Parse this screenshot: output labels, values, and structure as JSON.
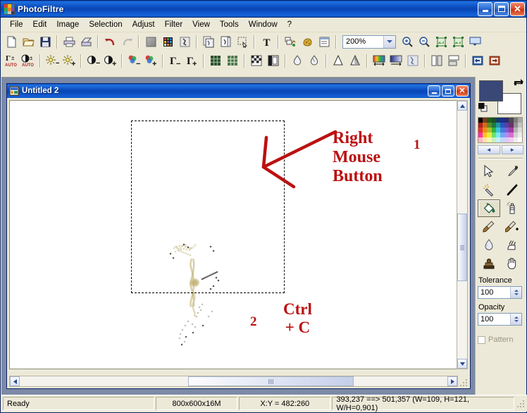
{
  "window": {
    "title": "PhotoFiltre",
    "icon": "photofiltre-app-icon",
    "minimize_label": "_",
    "maximize_label": "□",
    "close_label": "✕"
  },
  "menu": {
    "items": [
      {
        "label": "File"
      },
      {
        "label": "Edit"
      },
      {
        "label": "Image"
      },
      {
        "label": "Selection"
      },
      {
        "label": "Adjust"
      },
      {
        "label": "Filter"
      },
      {
        "label": "View"
      },
      {
        "label": "Tools"
      },
      {
        "label": "Window"
      },
      {
        "label": "?"
      }
    ]
  },
  "toolbar_main": {
    "zoom_value": "200%",
    "buttons": [
      {
        "name": "new-icon",
        "title": "New"
      },
      {
        "name": "open-icon",
        "title": "Open"
      },
      {
        "name": "save-icon",
        "title": "Save"
      },
      {
        "name": "print-icon",
        "title": "Print"
      },
      {
        "name": "print-preview-icon",
        "title": "Print preview"
      },
      {
        "name": "undo-icon",
        "title": "Undo"
      },
      {
        "name": "redo-icon",
        "title": "Redo"
      },
      {
        "name": "gradient-icon",
        "title": "Gradient"
      },
      {
        "name": "palette-icon",
        "title": "Color palette"
      },
      {
        "name": "transparency-icon",
        "title": "Transparency"
      },
      {
        "name": "copy-image-icon",
        "title": "Copy image"
      },
      {
        "name": "paste-image-icon",
        "title": "Paste image"
      },
      {
        "name": "crop-selection-icon",
        "title": "Crop selection"
      },
      {
        "name": "text-icon",
        "title": "Text"
      },
      {
        "name": "pipette-layer-icon",
        "title": "Layer"
      },
      {
        "name": "sponge-icon",
        "title": "Sponge"
      },
      {
        "name": "module-icon",
        "title": "Module"
      },
      {
        "name": "zoom-in-icon",
        "title": "Zoom in"
      },
      {
        "name": "zoom-out-icon",
        "title": "Zoom out"
      },
      {
        "name": "fit-image-icon",
        "title": "Fit image"
      },
      {
        "name": "actual-size-icon",
        "title": "Actual size"
      },
      {
        "name": "fullscreen-icon",
        "title": "Full screen"
      }
    ]
  },
  "toolbar_adjust": {
    "buttons": [
      {
        "name": "auto-gamma-icon",
        "title": "Auto level"
      },
      {
        "name": "auto-contrast-icon",
        "title": "Auto contrast"
      },
      {
        "name": "brightness-down-icon",
        "title": "Brightness -"
      },
      {
        "name": "brightness-up-icon",
        "title": "Brightness +"
      },
      {
        "name": "contrast-down-icon",
        "title": "Contrast -"
      },
      {
        "name": "contrast-up-icon",
        "title": "Contrast +"
      },
      {
        "name": "saturation-down-icon",
        "title": "Saturation -"
      },
      {
        "name": "saturation-up-icon",
        "title": "Saturation +"
      },
      {
        "name": "gamma-down-icon",
        "title": "Gamma -"
      },
      {
        "name": "gamma-up-icon",
        "title": "Gamma +"
      },
      {
        "name": "dither-dark-icon",
        "title": "Dither"
      },
      {
        "name": "dither-light-icon",
        "title": "Dither light"
      },
      {
        "name": "checker-icon",
        "title": "Checkerboard"
      },
      {
        "name": "frame-icon",
        "title": "Frame"
      },
      {
        "name": "drop-blur-icon",
        "title": "Blur"
      },
      {
        "name": "drop-sharpen-icon",
        "title": "Sharpen"
      },
      {
        "name": "triangle-soft-icon",
        "title": "Soften"
      },
      {
        "name": "triangle-hard-icon",
        "title": "Sharpen edges"
      },
      {
        "name": "gradient-h-icon",
        "title": "Horizontal gradient"
      },
      {
        "name": "gradient-linear-icon",
        "title": "Linear gradient"
      },
      {
        "name": "transparent-mask-icon",
        "title": "Mask"
      },
      {
        "name": "flip-h-icon",
        "title": "Flip horizontal"
      },
      {
        "name": "flip-v-icon",
        "title": "Flip vertical"
      },
      {
        "name": "rotate-left-icon",
        "title": "Rotate left"
      },
      {
        "name": "rotate-right-icon",
        "title": "Rotate right"
      }
    ]
  },
  "document": {
    "title": "Untitled 2",
    "icon": "image-document-icon",
    "minimize_label": "_",
    "restore_label": "□",
    "close_label": "✕"
  },
  "annotations": [
    {
      "name": "annotation-right-mouse-button",
      "text": "Right\nMouse\nButton"
    },
    {
      "name": "annotation-step-one",
      "text": "1"
    },
    {
      "name": "annotation-ctrl-c",
      "text": "Ctrl\n+ C"
    },
    {
      "name": "annotation-step-two",
      "text": "2"
    }
  ],
  "annotation_color": "#bb1111",
  "palette": {
    "prev_label": "◄",
    "next_label": "►",
    "foreground_color": "#3a4878",
    "background_color": "#ffffff",
    "swap_icon": "swap-colors-icon",
    "default_icon": "default-colors-icon",
    "colors": [
      "#000000",
      "#7a3b18",
      "#1d5b1d",
      "#1c4f22",
      "#0f3d64",
      "#1a2f8a",
      "#2a2a72",
      "#4a4a4a",
      "#7d7d7d",
      "#a8a8a8",
      "#b42020",
      "#d06a16",
      "#5c8c22",
      "#1f7a3c",
      "#2196a4",
      "#2457c8",
      "#5b3fa0",
      "#6e2e6e",
      "#909090",
      "#c4c4c4",
      "#e63232",
      "#f08a1c",
      "#a8c22a",
      "#35b341",
      "#39c8d8",
      "#3f7de0",
      "#7b5fd0",
      "#a838a0",
      "#b4b4b4",
      "#dcdcdc",
      "#ff2fae",
      "#ffc21c",
      "#e8ee3c",
      "#6fe06a",
      "#7ae8ec",
      "#6fa8f4",
      "#a98ef0",
      "#e06ad0",
      "#d2d2d2",
      "#ececec",
      "#ffb6c9",
      "#ffe1a8",
      "#f4f7b4",
      "#c7f0bd",
      "#c4f1f4",
      "#c2d8fb",
      "#d8cdf8",
      "#f6c9ef",
      "#eeeeee",
      "#ffffff"
    ]
  },
  "tools": [
    {
      "name": "tool-selection-arrow",
      "icon": "cursor-arrow-icon",
      "active": false
    },
    {
      "name": "tool-color-picker",
      "icon": "eyedropper-icon",
      "active": false
    },
    {
      "name": "tool-magic-wand",
      "icon": "magic-wand-icon",
      "active": false
    },
    {
      "name": "tool-line",
      "icon": "line-icon",
      "active": false
    },
    {
      "name": "tool-paint-bucket",
      "icon": "paint-bucket-icon",
      "active": true
    },
    {
      "name": "tool-airbrush",
      "icon": "spray-can-icon",
      "active": false
    },
    {
      "name": "tool-paintbrush",
      "icon": "paintbrush-icon",
      "active": false
    },
    {
      "name": "tool-advanced-brush",
      "icon": "paintbrush-plus-icon",
      "active": false
    },
    {
      "name": "tool-blur-drop",
      "icon": "water-drop-icon",
      "active": false
    },
    {
      "name": "tool-smudge",
      "icon": "smudge-finger-icon",
      "active": false
    },
    {
      "name": "tool-clone-stamp",
      "icon": "clone-stamp-icon",
      "active": false
    },
    {
      "name": "tool-hand",
      "icon": "hand-icon",
      "active": false
    }
  ],
  "options": {
    "tolerance_label": "Tolerance",
    "tolerance_value": "100",
    "opacity_label": "Opacity",
    "opacity_value": "100",
    "pattern_label": "Pattern",
    "pattern_checked": false
  },
  "statusbar": {
    "ready": "Ready",
    "dimensions": "800x600x16M",
    "coordinates": "X:Y = 482:260",
    "selection": "393,237 ==> 501,357 (W=109, H=121, W/H=0,901)"
  },
  "scrollbars": {
    "up_label": "▲",
    "down_label": "▼",
    "left_label": "◄",
    "right_label": "►"
  }
}
